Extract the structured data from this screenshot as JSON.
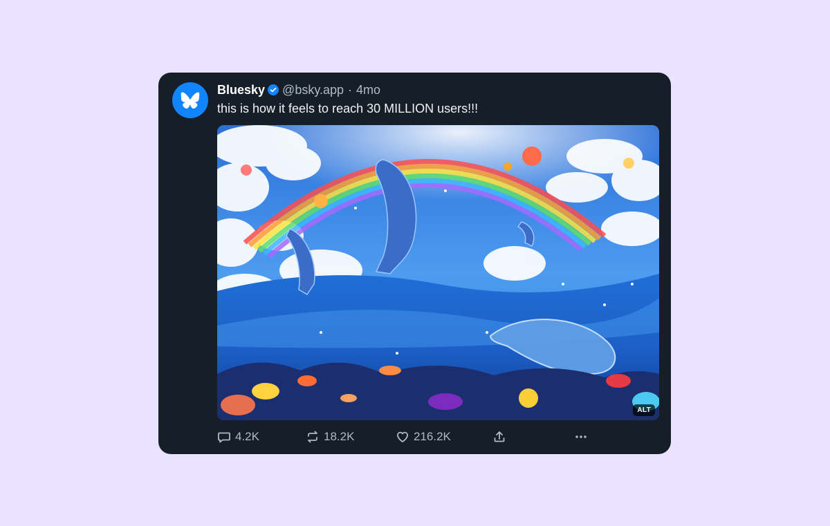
{
  "post": {
    "author_name": "Bluesky",
    "handle": "@bsky.app",
    "separator": "·",
    "time": "4mo",
    "text": "this is how it feels to reach 30 MILLION users!!!",
    "verified": true,
    "avatar_icon": "butterfly-icon",
    "image_alt_badge": "ALT"
  },
  "actions": {
    "reply_count": "4.2K",
    "repost_count": "18.2K",
    "like_count": "216.2K"
  },
  "colors": {
    "page_background": "#e9e3ff",
    "card_background": "#161e27",
    "brand_blue": "#1185fe",
    "muted_text": "#aebbc9"
  }
}
